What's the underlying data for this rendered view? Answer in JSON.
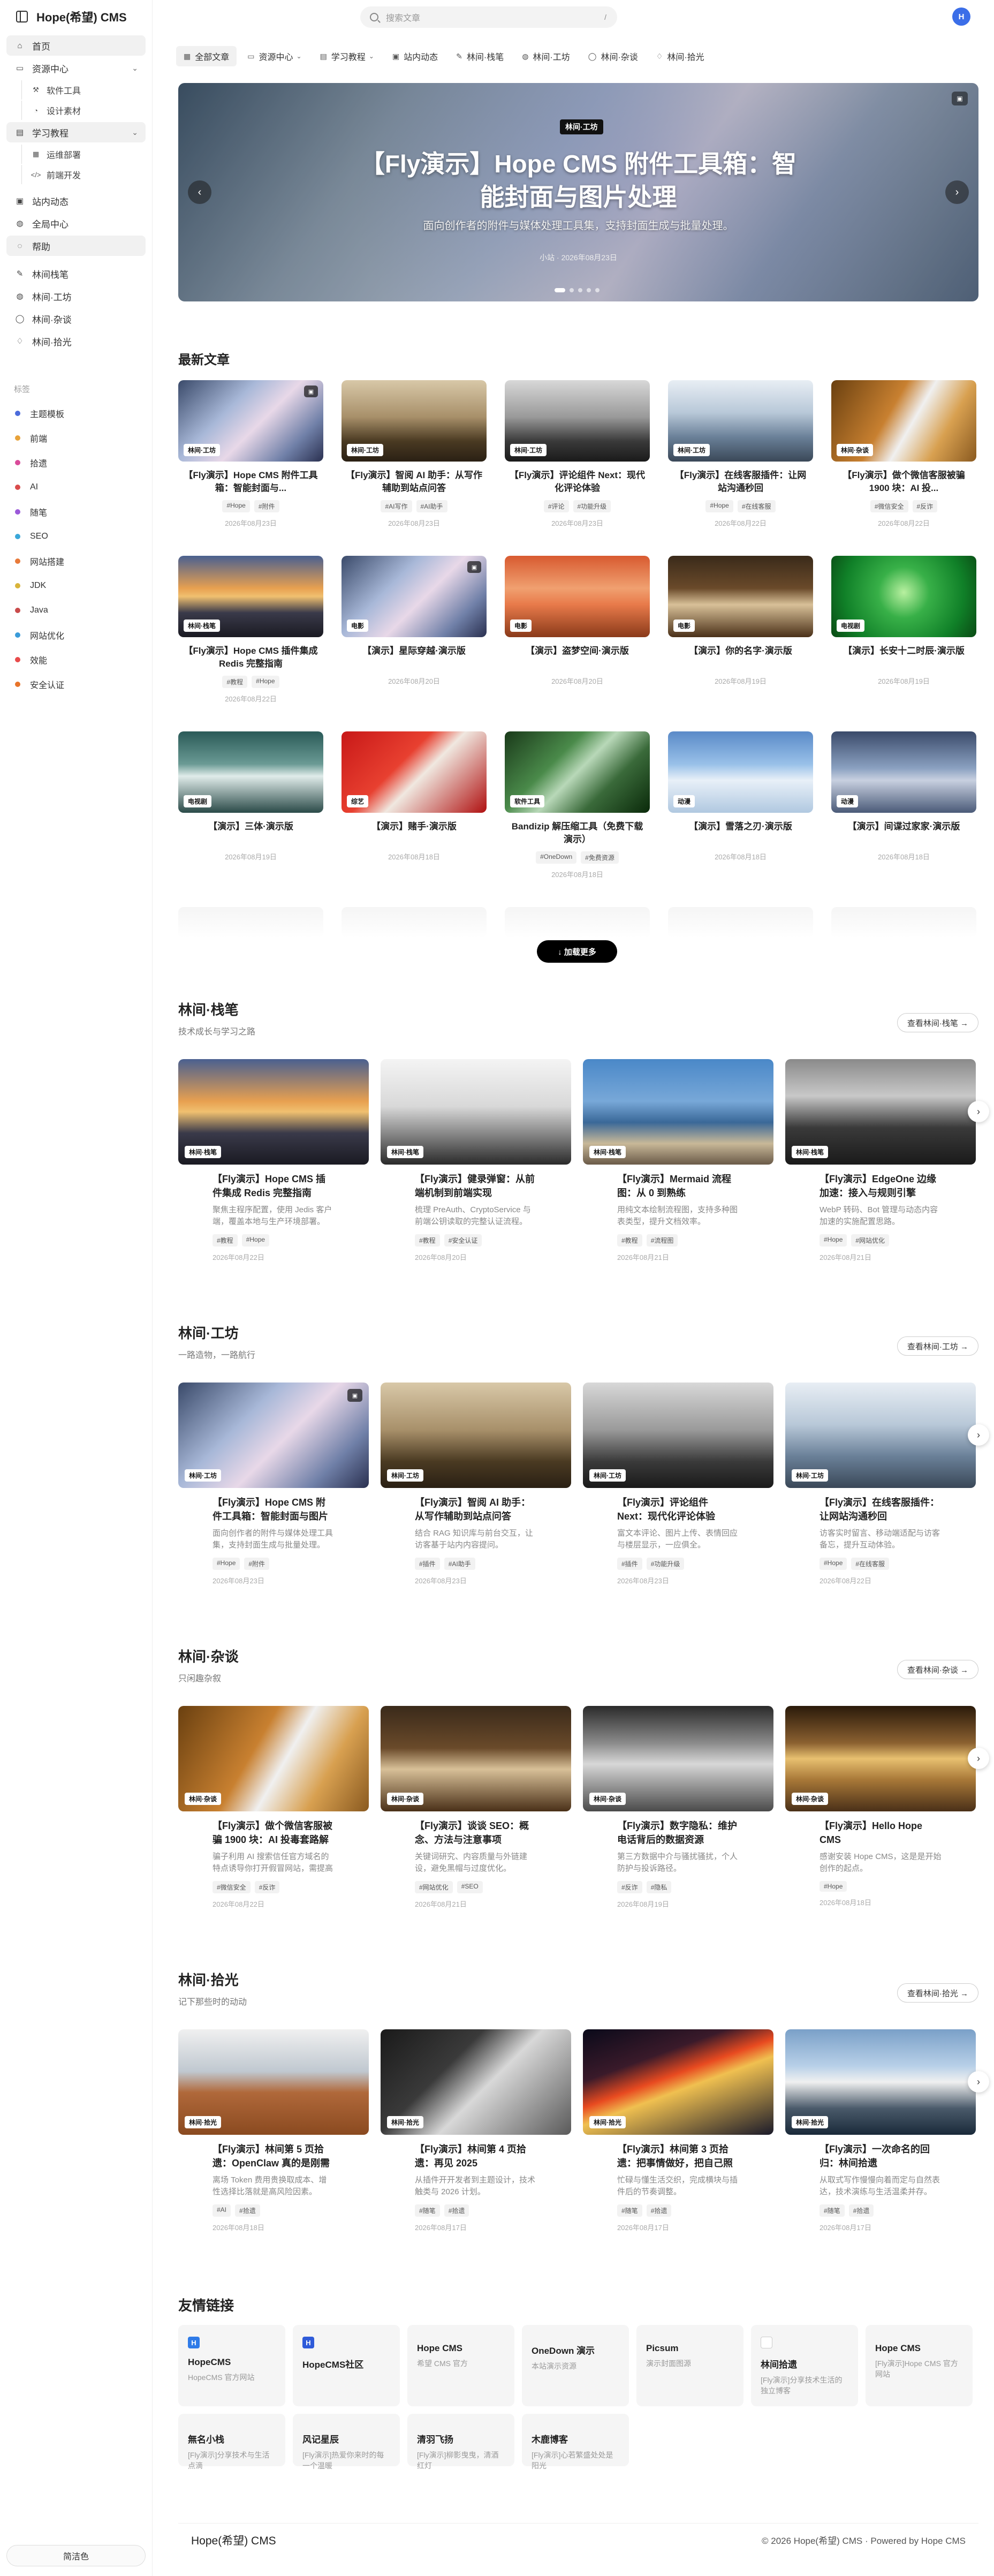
{
  "app": {
    "title": "Hope(希望) CMS"
  },
  "search": {
    "placeholder": "搜索文章",
    "shortcut": "/"
  },
  "user": {
    "avatar_letter": "H"
  },
  "sidebar": {
    "items": [
      {
        "label": "首页",
        "icon": "home-icon",
        "active": true
      },
      {
        "label": "资源中心",
        "icon": "folder-icon",
        "expanded": true
      },
      {
        "label": "软件工具",
        "icon": "tool-icon",
        "sub": true
      },
      {
        "label": "设计素材",
        "icon": "palette-icon",
        "sub": true
      },
      {
        "label": "学习教程",
        "icon": "book-icon",
        "active": true,
        "expanded": true
      },
      {
        "label": "运维部署",
        "icon": "server-icon",
        "sub": true
      },
      {
        "label": "前端开发",
        "icon": "code-icon",
        "sub": true
      },
      {
        "label": "站内动态",
        "icon": "news-icon"
      },
      {
        "label": "全局中心",
        "icon": "globe-icon"
      },
      {
        "label": "帮助",
        "icon": "help-icon",
        "active": true
      },
      {
        "label": "林间栈笔",
        "icon": "pen-icon"
      },
      {
        "label": "林间·工坊",
        "icon": "globe-icon"
      },
      {
        "label": "林间·杂谈",
        "icon": "chat-icon"
      },
      {
        "label": "林间·拾光",
        "icon": "lightbulb-icon"
      }
    ],
    "tags_title": "标签",
    "tags": [
      {
        "label": "主题模板",
        "color": "#4b6bdb"
      },
      {
        "label": "前端",
        "color": "#e8a23a"
      },
      {
        "label": "拾遗",
        "color": "#d94b9a"
      },
      {
        "label": "AI",
        "color": "#d94b4b"
      },
      {
        "label": "随笔",
        "color": "#9b59d9"
      },
      {
        "label": "SEO",
        "color": "#3aa7d9"
      },
      {
        "label": "网站搭建",
        "color": "#e87a3a"
      },
      {
        "label": "JDK",
        "color": "#d9b43a"
      },
      {
        "label": "Java",
        "color": "#c94b4b"
      },
      {
        "label": "网站优化",
        "color": "#3a9bd9"
      },
      {
        "label": "效能",
        "color": "#e84b4b"
      },
      {
        "label": "安全认证",
        "color": "#e8742a"
      }
    ],
    "footer": "简洁色"
  },
  "categories": [
    {
      "label": "全部文章",
      "icon": "grid-icon",
      "active": true
    },
    {
      "label": "资源中心",
      "icon": "folder-icon",
      "chevron": true
    },
    {
      "label": "学习教程",
      "icon": "book-icon",
      "chevron": true
    },
    {
      "label": "站内动态",
      "icon": "news-icon"
    },
    {
      "label": "林间·栈笔",
      "icon": "pen-icon"
    },
    {
      "label": "林间·工坊",
      "icon": "globe-icon"
    },
    {
      "label": "林间·杂谈",
      "icon": "chat-icon"
    },
    {
      "label": "林间·拾光",
      "icon": "lightbulb-icon"
    }
  ],
  "hero": {
    "badge": "林间·工坊",
    "title": "【Fly演示】Hope CMS 附件工具箱：智能封面与图片处理",
    "subtitle": "面向创作者的附件与媒体处理工具集，支持封面生成与批量处理。",
    "meta": "小站 · 2026年08月23日"
  },
  "latest": {
    "title": "最新文章",
    "load_more": "↓ 加载更多",
    "cards": [
      {
        "title": "【Fly演示】Hope CMS 附件工具箱：智能封面与...",
        "badge": "林间·工坊",
        "tags": [
          "#Hope",
          "#附件"
        ],
        "date": "2026年08月23日",
        "img": "anime",
        "cam": true
      },
      {
        "title": "【Fly演示】智阅 AI 助手：从写作辅助到站点问答",
        "badge": "林间·工坊",
        "tags": [
          "#AI写作",
          "#AI助手"
        ],
        "date": "2026年08月23日",
        "img": "sepia",
        "cam": false
      },
      {
        "title": "【Fly演示】评论组件 Next：现代化评论体验",
        "badge": "林间·工坊",
        "tags": [
          "#评论",
          "#功能升级"
        ],
        "date": "2026年08月23日",
        "img": "bw",
        "cam": false
      },
      {
        "title": "【Fly演示】在线客服插件：让网站沟通秒回",
        "badge": "林间·工坊",
        "tags": [
          "#Hope",
          "#在线客服"
        ],
        "date": "2026年08月22日",
        "img": "bridge",
        "cam": false
      },
      {
        "title": "【Fly演示】做个微信客服被骗 1900 块：AI 投...",
        "badge": "林间·杂谈",
        "tags": [
          "#微信安全",
          "#反诈"
        ],
        "date": "2026年08月22日",
        "img": "book",
        "cam": false
      },
      {
        "title": "【Fly演示】Hope CMS 插件集成 Redis 完整指南",
        "badge": "林间·栈笔",
        "tags": [
          "#教程",
          "#Hope"
        ],
        "date": "2026年08月22日",
        "img": "sunset",
        "cam": false
      },
      {
        "title": "【演示】星际穿越·演示版",
        "badge": "电影",
        "tags": [],
        "date": "2026年08月20日",
        "img": "anime",
        "cam": true
      },
      {
        "title": "【演示】盗梦空间·演示版",
        "badge": "电影",
        "tags": [],
        "date": "2026年08月20日",
        "img": "orange",
        "cam": false
      },
      {
        "title": "【演示】你的名字·演示版",
        "badge": "电影",
        "tags": [],
        "date": "2026年08月19日",
        "img": "bible",
        "cam": false
      },
      {
        "title": "【演示】长安十二时辰·演示版",
        "badge": "电视剧",
        "tags": [],
        "date": "2026年08月19日",
        "img": "leaf",
        "cam": false
      },
      {
        "title": "【演示】三体·演示版",
        "badge": "电视剧",
        "tags": [],
        "date": "2026年08月19日",
        "img": "water",
        "cam": false
      },
      {
        "title": "【演示】赌手·演示版",
        "badge": "综艺",
        "tags": [],
        "date": "2026年08月18日",
        "img": "red",
        "cam": false
      },
      {
        "title": "Bandizip 解压缩工具（免费下载演示）",
        "badge": "软件工具",
        "tags": [
          "#OneDown",
          "#免费资源"
        ],
        "date": "2026年08月18日",
        "img": "field",
        "cam": false
      },
      {
        "title": "【演示】雪落之刃·演示版",
        "badge": "动漫",
        "tags": [],
        "date": "2026年08月18日",
        "img": "sky",
        "cam": false
      },
      {
        "title": "【演示】间谍过家家·演示版",
        "badge": "动漫",
        "tags": [],
        "date": "2026年08月18日",
        "img": "cloud",
        "cam": false
      }
    ]
  },
  "sections": [
    {
      "title": "林间·栈笔",
      "desc": "技术成长与学习之路",
      "button": "查看林间·栈笔 →",
      "cards": [
        {
          "title": "【Fly演示】Hope CMS 插件集成 Redis 完整指南",
          "excerpt": "聚焦主程序配置，使用 Jedis 客户端，覆盖本地与生产环境部署。",
          "badge": "林间·栈笔",
          "tags": [
            "#教程",
            "#Hope"
          ],
          "date": "2026年08月22日",
          "img": "sunset",
          "cam": false
        },
        {
          "title": "【Fly演示】健录弹窗：从前端机制到前端实现",
          "excerpt": "梳理 PreAuth、CryptoService 与前端公钥读取的完整认证流程。",
          "badge": "林间·栈笔",
          "tags": [
            "#教程",
            "#安全认证"
          ],
          "date": "2026年08月20日",
          "img": "mist",
          "cam": false
        },
        {
          "title": "【Fly演示】Mermaid 流程图：从 0 到熟练",
          "excerpt": "用纯文本绘制流程图，支持多种图表类型，提升文档效率。",
          "badge": "林间·栈笔",
          "tags": [
            "#教程",
            "#流程图"
          ],
          "date": "2026年08月21日",
          "img": "beach",
          "cam": false
        },
        {
          "title": "【Fly演示】EdgeOne 边缘加速：接入与规则引擎",
          "excerpt": "WebP 转码、Bot 管理与动态内容加速的实施配置思路。",
          "badge": "林间·栈笔",
          "tags": [
            "#Hope",
            "#网站优化"
          ],
          "date": "2026年08月21日",
          "img": "car",
          "cam": false
        }
      ]
    },
    {
      "title": "林间·工坊",
      "desc": "一路造物，一路航行",
      "button": "查看林间·工坊 →",
      "cards": [
        {
          "title": "【Fly演示】Hope CMS 附件工具箱：智能封面与图片处理",
          "excerpt": "面向创作者的附件与媒体处理工具集，支持封面生成与批量处理。",
          "badge": "林间·工坊",
          "tags": [
            "#Hope",
            "#附件"
          ],
          "date": "2026年08月23日",
          "img": "anime",
          "cam": true
        },
        {
          "title": "【Fly演示】智阅 AI 助手：从写作辅助到站点问答",
          "excerpt": "结合 RAG 知识库与前台交互，让访客基于站内内容提问。",
          "badge": "林间·工坊",
          "tags": [
            "#插件",
            "#AI助手"
          ],
          "date": "2026年08月23日",
          "img": "sepia",
          "cam": false
        },
        {
          "title": "【Fly演示】评论组件 Next：现代化评论体验",
          "excerpt": "富文本评论、图片上传、表情回应与楼层显示，一应俱全。",
          "badge": "林间·工坊",
          "tags": [
            "#插件",
            "#功能升级"
          ],
          "date": "2026年08月23日",
          "img": "bw",
          "cam": false
        },
        {
          "title": "【Fly演示】在线客服插件：让网站沟通秒回",
          "excerpt": "访客实时留言、移动端适配与访客备忘，提升互动体验。",
          "badge": "林间·工坊",
          "tags": [
            "#Hope",
            "#在线客服"
          ],
          "date": "2026年08月22日",
          "img": "bridge",
          "cam": false
        }
      ]
    },
    {
      "title": "林间·杂谈",
      "desc": "只闲趣杂叙",
      "button": "查看林间·杂谈 →",
      "cards": [
        {
          "title": "【Fly演示】做个微信客服被骗 1900 块：AI 投毒套路解析",
          "excerpt": "骗子利用 AI 搜索信任官方域名的特点诱导你打开假冒网站，需提高警惕。",
          "badge": "林间·杂谈",
          "tags": [
            "#微信安全",
            "#反诈"
          ],
          "date": "2026年08月22日",
          "img": "book",
          "cam": false
        },
        {
          "title": "【Fly演示】谈谈 SEO：概念、方法与注意事项",
          "excerpt": "关键词研究、内容质量与外链建设，避免黑帽与过度优化。",
          "badge": "林间·杂谈",
          "tags": [
            "#网站优化",
            "#SEO"
          ],
          "date": "2026年08月21日",
          "img": "bible",
          "cam": false
        },
        {
          "title": "【Fly演示】数字隐私：维护电话背后的数据资源",
          "excerpt": "第三方数据中介与骚扰骚扰，个人防护与投诉路径。",
          "badge": "林间·杂谈",
          "tags": [
            "#反诈",
            "#隐私"
          ],
          "date": "2026年08月19日",
          "img": "stairs",
          "cam": false
        },
        {
          "title": "【Fly演示】Hello Hope CMS",
          "excerpt": "感谢安装 Hope CMS，这是是开始创作的起点。",
          "badge": "林间·杂谈",
          "tags": [
            "#Hope"
          ],
          "date": "2026年08月18日",
          "img": "meadow",
          "cam": false
        }
      ]
    },
    {
      "title": "林间·拾光",
      "desc": "记下那些时的动动",
      "button": "查看林间·拾光 →",
      "cards": [
        {
          "title": "【Fly演示】林间第 5 页拾遗：OpenClaw 真的是刚需吗?",
          "excerpt": "离场 Token 费用贵换取成本、增性选择比落就是高风险因素。",
          "badge": "林间·拾光",
          "tags": [
            "#AI",
            "#拾遗"
          ],
          "date": "2026年08月18日",
          "img": "sign",
          "cam": false
        },
        {
          "title": "【Fly演示】林间第 4 页拾遗：再见 2025",
          "excerpt": "从插件开开发者到主题设计，技术触类与 2026 计划。",
          "badge": "林间·拾光",
          "tags": [
            "#随笔",
            "#拾遗"
          ],
          "date": "2026年08月17日",
          "img": "phone",
          "cam": false
        },
        {
          "title": "【Fly演示】林间第 3 页拾遗：把事情做好，把自己照顾好",
          "excerpt": "忙碌与懂生活交织，完成横块与插件后的节奏调整。",
          "badge": "林间·拾光",
          "tags": [
            "#随笔",
            "#拾遗"
          ],
          "date": "2026年08月17日",
          "img": "traffic",
          "cam": false
        },
        {
          "title": "【Fly演示】一次命名的回归：林间拾遗",
          "excerpt": "从取式写作慢慢向着而定与自然表达，技术演练与生活温柔并存。",
          "badge": "林间·拾光",
          "tags": [
            "#随笔",
            "#拾遗"
          ],
          "date": "2026年08月17日",
          "img": "mountain",
          "cam": false
        }
      ]
    }
  ],
  "links": {
    "title": "友情链接",
    "items": [
      {
        "name": "HopeCMS",
        "desc": "HopeCMS 官方网站",
        "icon": "H",
        "color": "#2f7be8"
      },
      {
        "name": "HopeCMS社区",
        "desc": "",
        "icon": "H",
        "color": "#2f5bd9"
      },
      {
        "name": "Hope CMS",
        "desc": "希望 CMS 官方",
        "icon": "",
        "color": ""
      },
      {
        "name": "OneDown 演示",
        "desc": "本站演示资源",
        "icon": "",
        "color": ""
      },
      {
        "name": "Picsum",
        "desc": "演示封面图源",
        "icon": "",
        "color": ""
      },
      {
        "name": "林间拾遗",
        "desc": "[Fly演示]分享技术生活的独立博客",
        "icon": "img",
        "color": "#ccc"
      },
      {
        "name": "Hope CMS",
        "desc": "[Fly演示]Hope CMS 官方网站",
        "icon": "",
        "color": ""
      },
      {
        "name": "無名小栈",
        "desc": "[Fly演示]分享技术与生活点滴",
        "icon": "",
        "color": ""
      },
      {
        "name": "风记星辰",
        "desc": "[Fly演示]热爱你来时的每一个温暖",
        "icon": "",
        "color": ""
      },
      {
        "name": "清羽飞扬",
        "desc": "[Fly演示]柳影曳曳，清酒红灯",
        "icon": "",
        "color": ""
      },
      {
        "name": "木鹿博客",
        "desc": "[Fly演示]心若繁盛处处是阳光",
        "icon": "",
        "color": ""
      }
    ]
  },
  "footer": {
    "left": "Hope(希望) CMS",
    "right": "© 2026 Hope(希望) CMS · Powered by Hope CMS"
  },
  "colors": {
    "accent": "#111111",
    "sidebar_active": "#f1f1f1"
  }
}
